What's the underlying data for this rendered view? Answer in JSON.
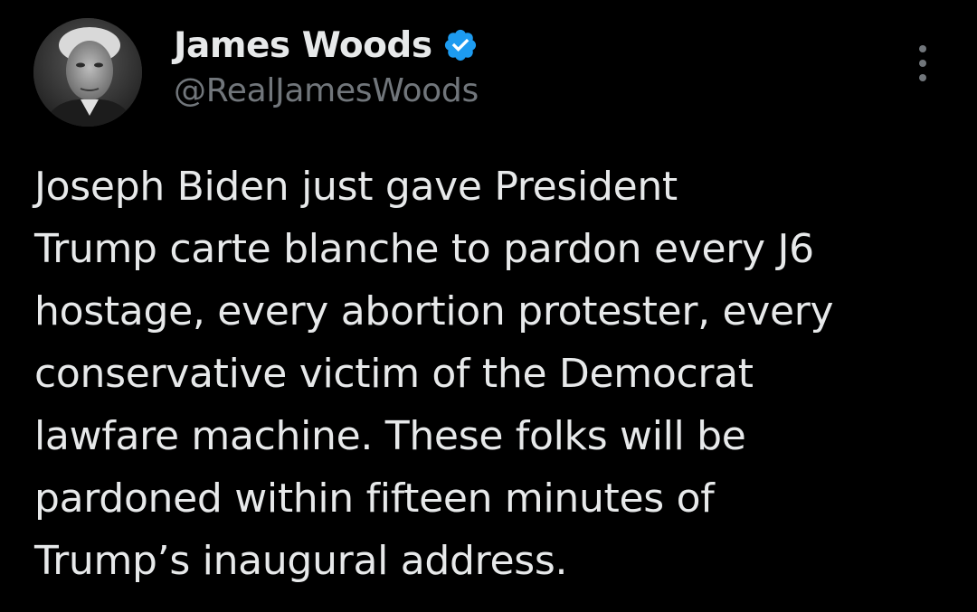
{
  "author": {
    "display_name": "James Woods",
    "handle": "@RealJamesWoods",
    "verified": true,
    "verified_color": "#1d9bf0",
    "avatar_icon": "profile-photo"
  },
  "menu": {
    "icon": "more-vertical-icon"
  },
  "tweet": {
    "lines": [
      "Joseph Biden just gave President",
      "Trump carte blanche to pardon every J6",
      "hostage, every abortion protester, every",
      "conservative victim of the Democrat",
      "lawfare machine. These folks will be",
      "pardoned within fifteen minutes of",
      "Trump’s inaugural address."
    ]
  },
  "colors": {
    "background": "#000000",
    "text": "#e7e9ea",
    "secondary": "#71767b",
    "accent": "#1d9bf0"
  }
}
